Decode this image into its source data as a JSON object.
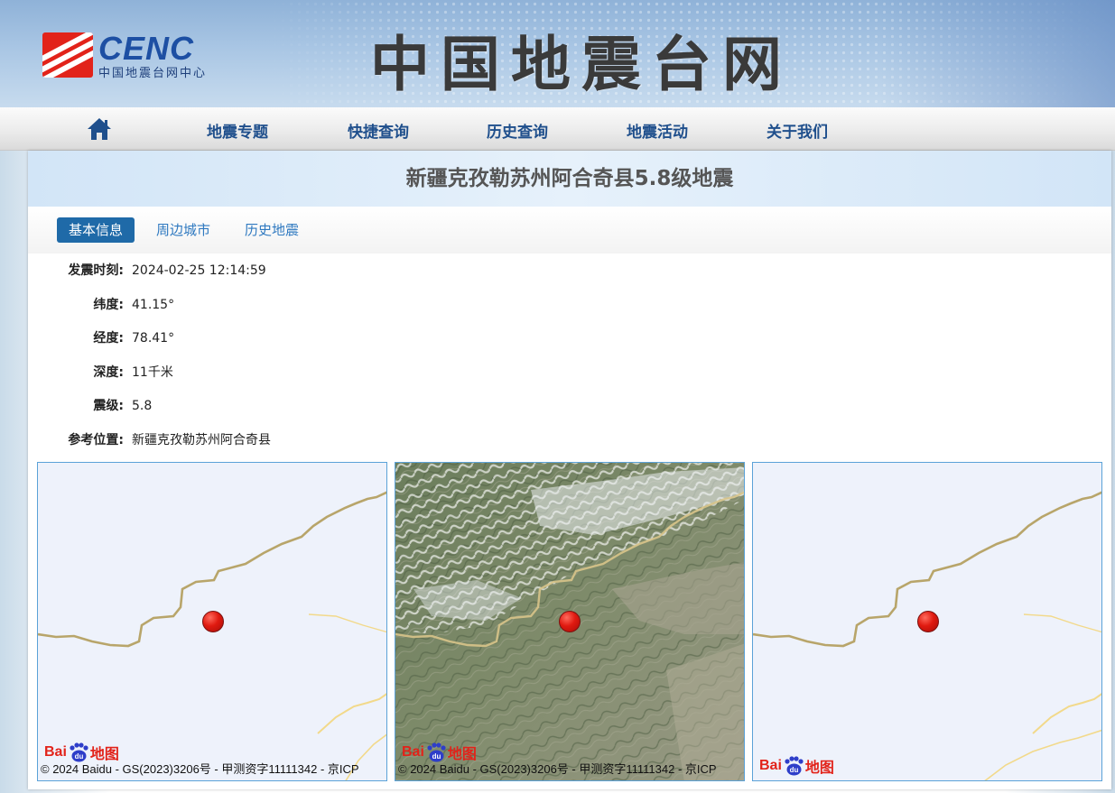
{
  "header": {
    "logo_text": "CENC",
    "logo_subtitle": "中国地震台网中心",
    "site_title": "中国地震台网"
  },
  "nav": {
    "home_icon": "home-icon",
    "items": [
      {
        "label": "地震专题"
      },
      {
        "label": "快捷查询"
      },
      {
        "label": "历史查询"
      },
      {
        "label": "地震活动"
      },
      {
        "label": "关于我们"
      }
    ]
  },
  "page": {
    "title": "新疆克孜勒苏州阿合奇县5.8级地震"
  },
  "tabs": [
    {
      "label": "基本信息",
      "active": true
    },
    {
      "label": "周边城市",
      "active": false
    },
    {
      "label": "历史地震",
      "active": false
    }
  ],
  "info": {
    "time": {
      "label": "发震时刻:",
      "value": "2024-02-25 12:14:59"
    },
    "latitude": {
      "label": "纬度:",
      "value": "41.15°"
    },
    "longitude": {
      "label": "经度:",
      "value": "78.41°"
    },
    "depth": {
      "label": "深度:",
      "value": "11千米"
    },
    "magnitude": {
      "label": "震级:",
      "value": "5.8"
    },
    "location": {
      "label": "参考位置:",
      "value": "新疆克孜勒苏州阿合奇县"
    }
  },
  "maps": {
    "baidu_logo_left": "Bai",
    "baidu_logo_du": "du",
    "baidu_logo_right": "地图",
    "copyright": "© 2024 Baidu - GS(2023)3206号 - 甲测资字11111342 - 京ICP",
    "epicenter_icon": "red-dot-marker-icon",
    "colors": {
      "border_line": "#b8a56a",
      "river": "#f2d98a",
      "map_bg": "#eef2fb"
    }
  },
  "colors": {
    "nav_text": "#1f4f8c",
    "tab_active_bg": "#1f6aa8",
    "tab_link": "#2f79c0",
    "logo_red": "#e2231a",
    "logo_blue": "#1d4fa3"
  }
}
